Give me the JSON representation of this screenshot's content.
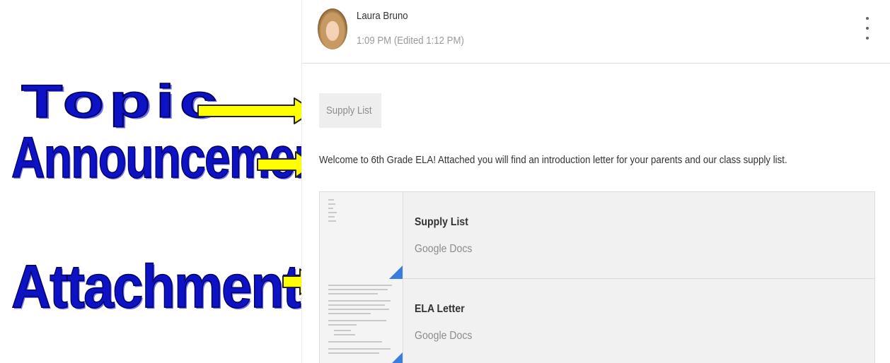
{
  "annotations": {
    "topic": "Topic",
    "announcement": "Announcement",
    "attachments": "Attachments"
  },
  "post": {
    "author": "Laura Bruno",
    "time": "1:09 PM (Edited 1:12 PM)",
    "topic": "Supply List",
    "announcement": "Welcome to 6th Grade ELA! Attached you will find an introduction letter for your parents and our class supply list.",
    "attachments": [
      {
        "title": "Supply List",
        "type": "Google Docs"
      },
      {
        "title": "ELA Letter",
        "type": "Google Docs"
      }
    ]
  },
  "icons": {
    "menu": "more-vert-icon",
    "arrow": "arrow-right-icon",
    "doc": "google-docs-icon"
  },
  "colors": {
    "label_blue": "#0d12c4",
    "arrow_yellow": "#ffff00",
    "docs_blue": "#3b7ddd"
  }
}
